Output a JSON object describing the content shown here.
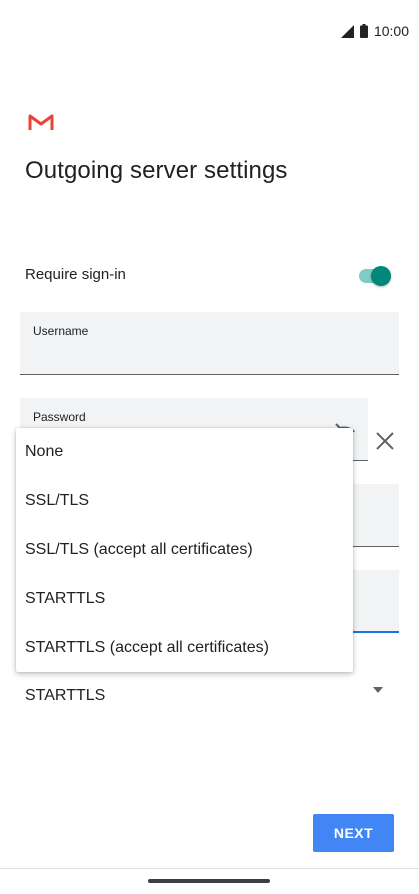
{
  "status_bar": {
    "time": "10:00"
  },
  "header": {
    "title": "Outgoing server settings"
  },
  "require_signin": {
    "label": "Require sign-in",
    "enabled": true
  },
  "fields": {
    "username": {
      "label": "Username",
      "value": ""
    },
    "password": {
      "label": "Password",
      "value": ""
    }
  },
  "security_type": {
    "selected": "STARTTLS",
    "options": [
      "None",
      "SSL/TLS",
      "SSL/TLS (accept all certificates)",
      "STARTTLS",
      "STARTTLS (accept all certificates)"
    ]
  },
  "actions": {
    "next_label": "NEXT"
  },
  "colors": {
    "accent": "#4285f4",
    "toggle_on": "#00897b",
    "toggle_track": "#80cbc4",
    "gmail_red": "#ea4335"
  }
}
